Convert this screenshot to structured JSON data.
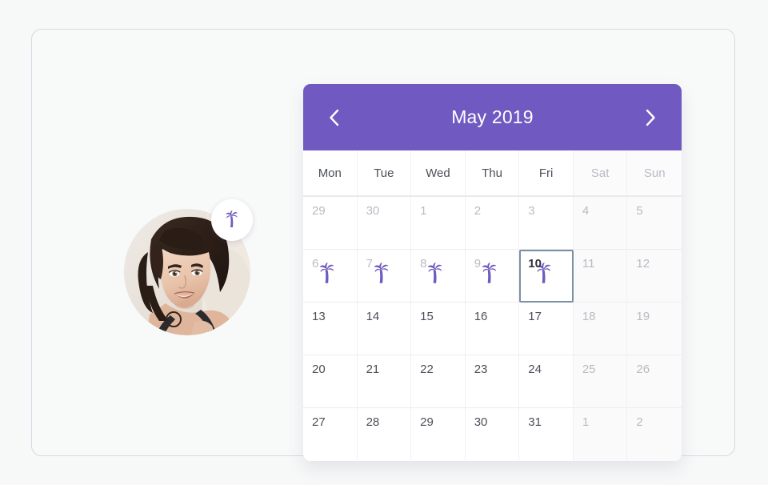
{
  "theme": {
    "accent_purple": "#7059c0",
    "page_background": "#f7f8f8",
    "card_border": "#d7d9e3",
    "selected_outline": "#7b90a3",
    "muted_text": "#b9bbc2",
    "day_text": "#4b4f58"
  },
  "avatar": {
    "alt": "user-profile-photo",
    "badge_icon": "palm-tree-icon"
  },
  "calendar": {
    "header": {
      "title": "May 2019",
      "prev_label": "‹",
      "prev_icon": "chevron-left-icon",
      "next_label": "›",
      "next_icon": "chevron-right-icon"
    },
    "weekdays": [
      {
        "label": "Mon",
        "weekend": false
      },
      {
        "label": "Tue",
        "weekend": false
      },
      {
        "label": "Wed",
        "weekend": false
      },
      {
        "label": "Thu",
        "weekend": false
      },
      {
        "label": "Fri",
        "weekend": false
      },
      {
        "label": "Sat",
        "weekend": true
      },
      {
        "label": "Sun",
        "weekend": true
      }
    ],
    "weeks": [
      [
        {
          "day": "29",
          "muted": true,
          "weekend": false,
          "vacation": false,
          "selected": false
        },
        {
          "day": "30",
          "muted": true,
          "weekend": false,
          "vacation": false,
          "selected": false
        },
        {
          "day": "1",
          "muted": true,
          "weekend": false,
          "vacation": false,
          "selected": false
        },
        {
          "day": "2",
          "muted": true,
          "weekend": false,
          "vacation": false,
          "selected": false
        },
        {
          "day": "3",
          "muted": true,
          "weekend": false,
          "vacation": false,
          "selected": false
        },
        {
          "day": "4",
          "muted": true,
          "weekend": true,
          "vacation": false,
          "selected": false
        },
        {
          "day": "5",
          "muted": true,
          "weekend": true,
          "vacation": false,
          "selected": false
        }
      ],
      [
        {
          "day": "6",
          "muted": true,
          "weekend": false,
          "vacation": true,
          "selected": false
        },
        {
          "day": "7",
          "muted": true,
          "weekend": false,
          "vacation": true,
          "selected": false
        },
        {
          "day": "8",
          "muted": true,
          "weekend": false,
          "vacation": true,
          "selected": false
        },
        {
          "day": "9",
          "muted": true,
          "weekend": false,
          "vacation": true,
          "selected": false
        },
        {
          "day": "10",
          "muted": false,
          "weekend": false,
          "vacation": true,
          "selected": true
        },
        {
          "day": "11",
          "muted": true,
          "weekend": true,
          "vacation": false,
          "selected": false
        },
        {
          "day": "12",
          "muted": true,
          "weekend": true,
          "vacation": false,
          "selected": false
        }
      ],
      [
        {
          "day": "13",
          "muted": false,
          "weekend": false,
          "vacation": false,
          "selected": false
        },
        {
          "day": "14",
          "muted": false,
          "weekend": false,
          "vacation": false,
          "selected": false
        },
        {
          "day": "15",
          "muted": false,
          "weekend": false,
          "vacation": false,
          "selected": false
        },
        {
          "day": "16",
          "muted": false,
          "weekend": false,
          "vacation": false,
          "selected": false
        },
        {
          "day": "17",
          "muted": false,
          "weekend": false,
          "vacation": false,
          "selected": false
        },
        {
          "day": "18",
          "muted": true,
          "weekend": true,
          "vacation": false,
          "selected": false
        },
        {
          "day": "19",
          "muted": true,
          "weekend": true,
          "vacation": false,
          "selected": false
        }
      ],
      [
        {
          "day": "20",
          "muted": false,
          "weekend": false,
          "vacation": false,
          "selected": false
        },
        {
          "day": "21",
          "muted": false,
          "weekend": false,
          "vacation": false,
          "selected": false
        },
        {
          "day": "22",
          "muted": false,
          "weekend": false,
          "vacation": false,
          "selected": false
        },
        {
          "day": "23",
          "muted": false,
          "weekend": false,
          "vacation": false,
          "selected": false
        },
        {
          "day": "24",
          "muted": false,
          "weekend": false,
          "vacation": false,
          "selected": false
        },
        {
          "day": "25",
          "muted": true,
          "weekend": true,
          "vacation": false,
          "selected": false
        },
        {
          "day": "26",
          "muted": true,
          "weekend": true,
          "vacation": false,
          "selected": false
        }
      ],
      [
        {
          "day": "27",
          "muted": false,
          "weekend": false,
          "vacation": false,
          "selected": false
        },
        {
          "day": "28",
          "muted": false,
          "weekend": false,
          "vacation": false,
          "selected": false
        },
        {
          "day": "29",
          "muted": false,
          "weekend": false,
          "vacation": false,
          "selected": false
        },
        {
          "day": "30",
          "muted": false,
          "weekend": false,
          "vacation": false,
          "selected": false
        },
        {
          "day": "31",
          "muted": false,
          "weekend": false,
          "vacation": false,
          "selected": false
        },
        {
          "day": "1",
          "muted": true,
          "weekend": true,
          "vacation": false,
          "selected": false
        },
        {
          "day": "2",
          "muted": true,
          "weekend": true,
          "vacation": false,
          "selected": false
        }
      ]
    ]
  }
}
